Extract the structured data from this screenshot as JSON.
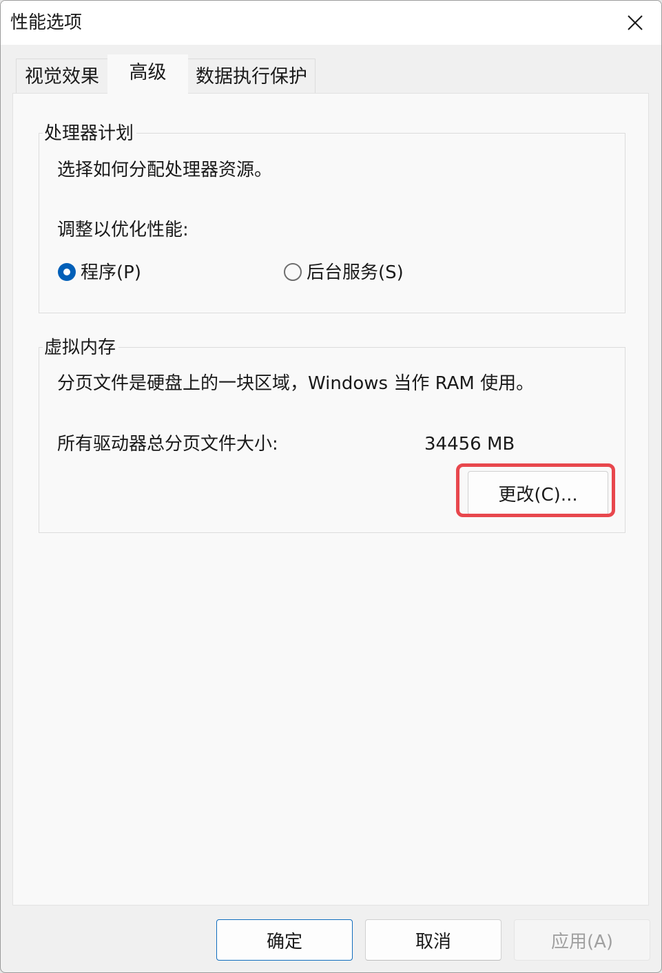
{
  "window": {
    "title": "性能选项",
    "close_icon": "close-icon"
  },
  "tabs": [
    {
      "label": "视觉效果",
      "active": false
    },
    {
      "label": "高级",
      "active": true
    },
    {
      "label": "数据执行保护",
      "active": false
    }
  ],
  "processor": {
    "group_title": "处理器计划",
    "description": "选择如何分配处理器资源。",
    "adjust_label": "调整以优化性能:",
    "options": [
      {
        "label": "程序(P)",
        "checked": true
      },
      {
        "label": "后台服务(S)",
        "checked": false
      }
    ]
  },
  "virtual_memory": {
    "group_title": "虚拟内存",
    "description": "分页文件是硬盘上的一块区域，Windows 当作 RAM 使用。",
    "total_label": "所有驱动器总分页文件大小:",
    "total_value": "34456 MB",
    "change_button": "更改(C)..."
  },
  "footer": {
    "ok": "确定",
    "cancel": "取消",
    "apply": "应用(A)"
  },
  "colors": {
    "accent": "#005fb8",
    "highlight": "#e8474d"
  }
}
